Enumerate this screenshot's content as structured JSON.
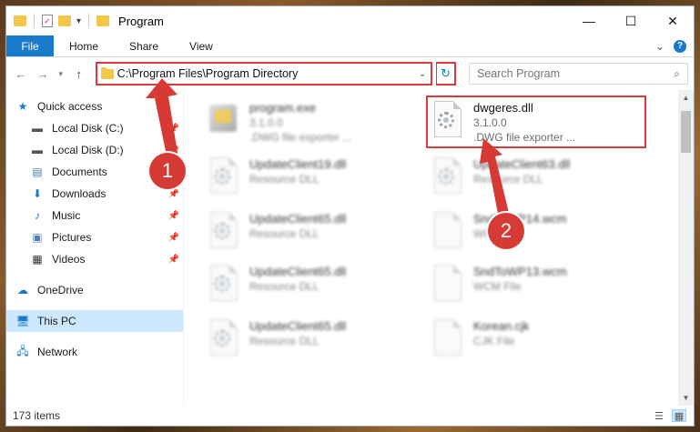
{
  "window": {
    "title": "Program",
    "controls": {
      "minimize": "—",
      "maximize": "☐",
      "close": "✕"
    }
  },
  "ribbon": {
    "file_tab": "File",
    "tabs": [
      "Home",
      "Share",
      "View"
    ],
    "expand": "⌄",
    "help": "?"
  },
  "address_bar": {
    "path": "C:\\Program Files\\Program Directory",
    "dropdown": "⌄",
    "refresh": "↻"
  },
  "search": {
    "placeholder": "Search Program",
    "icon": "magnifier-icon"
  },
  "nav_pane": {
    "quick_access": "Quick access",
    "items": [
      {
        "label": "Local Disk (C:)",
        "icon": "drive-icon",
        "pinned": true
      },
      {
        "label": "Local Disk (D:)",
        "icon": "drive-icon",
        "pinned": true
      },
      {
        "label": "Documents",
        "icon": "documents-icon",
        "pinned": true
      },
      {
        "label": "Downloads",
        "icon": "download-icon",
        "pinned": true
      },
      {
        "label": "Music",
        "icon": "music-icon",
        "pinned": true
      },
      {
        "label": "Pictures",
        "icon": "pictures-icon",
        "pinned": true
      },
      {
        "label": "Videos",
        "icon": "videos-icon",
        "pinned": true
      }
    ],
    "onedrive": "OneDrive",
    "this_pc": "This PC",
    "network": "Network"
  },
  "files": [
    {
      "name": "program.exe",
      "line1": "3.1.0.0",
      "line2": ".DWG file exporter ...",
      "icon": "exe-icon",
      "blurred": true
    },
    {
      "name": "dwgeres.dll",
      "line1": "3.1.0.0",
      "line2": ".DWG file exporter ...",
      "icon": "dll-gear-icon",
      "blurred": false
    },
    {
      "name": "UpdateClient19.dll",
      "line1": "Resource DLL",
      "icon": "dll-gear-icon",
      "blurred": true
    },
    {
      "name": "UpdateClient63.dll",
      "line1": "Resource DLL",
      "icon": "dll-gear-icon",
      "blurred": true
    },
    {
      "name": "UpdateClient65.dll",
      "line1": "Resource DLL",
      "icon": "dll-gear-icon",
      "blurred": true
    },
    {
      "name": "SndToWP14.wcm",
      "line1": "WCM File",
      "icon": "file-icon",
      "blurred": true
    },
    {
      "name": "UpdateClient65.dll",
      "line1": "Resource DLL",
      "icon": "dll-gear-icon",
      "blurred": true
    },
    {
      "name": "SndToWP13.wcm",
      "line1": "WCM File",
      "icon": "file-icon",
      "blurred": true
    },
    {
      "name": "UpdateClient65.dll",
      "line1": "Resource DLL",
      "icon": "dll-gear-icon",
      "blurred": true
    },
    {
      "name": "Korean.cjk",
      "line1": "CJK File",
      "icon": "file-icon",
      "blurred": true
    }
  ],
  "annotations": {
    "marker1": "1",
    "marker2": "2",
    "color": "#d63a34"
  },
  "status": {
    "item_count": "173 items"
  }
}
